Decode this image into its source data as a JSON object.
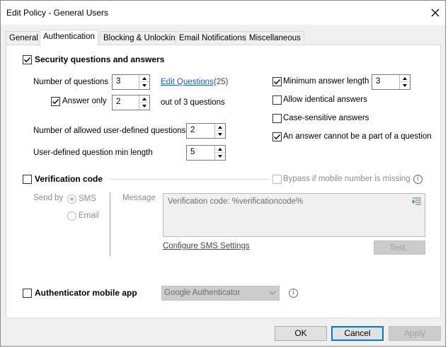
{
  "window": {
    "title": "Edit Policy - General Users"
  },
  "tabs": [
    {
      "label": "General"
    },
    {
      "label": "Authentication"
    },
    {
      "label": "Blocking & Unlocking"
    },
    {
      "label": "Email Notifications"
    },
    {
      "label": "Miscellaneous"
    }
  ],
  "security": {
    "header": "Security questions and answers",
    "num_questions_label": "Number of questions",
    "num_questions_value": "3",
    "edit_questions_link": "Edit Questions",
    "edit_questions_count": "(25)",
    "answer_only_label": "Answer only",
    "answer_only_value": "2",
    "out_of_text": "out of 3 questions",
    "allowed_user_defined_label": "Number of allowed user-defined questions",
    "allowed_user_defined_value": "2",
    "min_length_label": "User-defined question min length",
    "min_length_value": "5",
    "min_answer_length_label": "Minimum answer length",
    "min_answer_length_value": "3",
    "allow_identical_label": "Allow identical answers",
    "case_sensitive_label": "Case-sensitive answers",
    "answer_not_part_label": "An answer cannot be a part of a question"
  },
  "verification": {
    "header": "Verification code",
    "bypass_label": "Bypass if mobile number is missing",
    "send_by_label": "Send by",
    "sms_label": "SMS",
    "email_label": "Email",
    "message_label": "Message",
    "message_value": "Verification code: %verificationcode%",
    "configure_sms_link": "Configure SMS Settings",
    "test_button": "Test.."
  },
  "authenticator": {
    "header": "Authenticator mobile app",
    "selected_app": "Google Authenticator"
  },
  "footer": {
    "ok": "OK",
    "cancel": "Cancel",
    "apply": "Apply"
  }
}
